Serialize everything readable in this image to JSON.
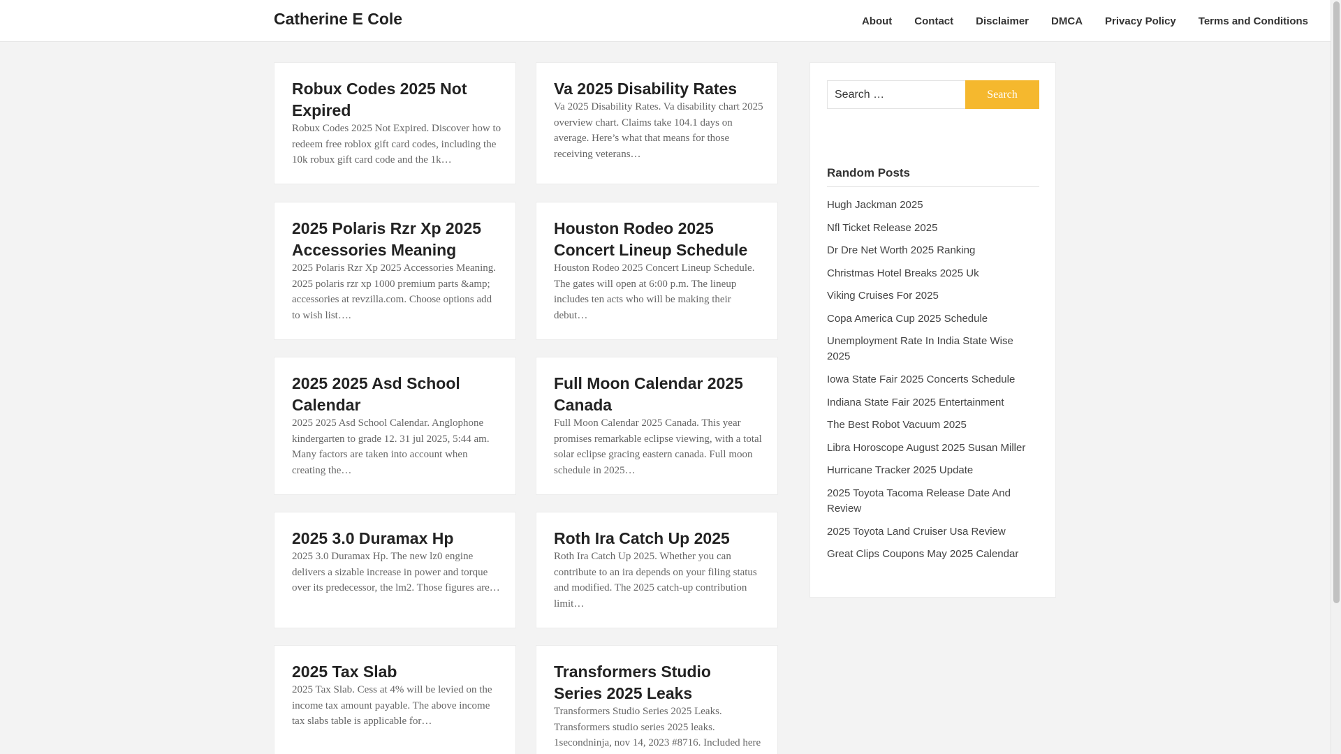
{
  "header": {
    "site_title": "Catherine E Cole",
    "nav": [
      "About",
      "Contact",
      "Disclaimer",
      "DMCA",
      "Privacy Policy",
      "Terms and Conditions"
    ]
  },
  "posts": [
    {
      "title": "Robux Codes 2025 Not Expired",
      "excerpt": "Robux Codes 2025 Not Expired. Discover how to redeem free roblox gift card codes, including the 10k robux gift card code and the 1k…"
    },
    {
      "title": "Va 2025 Disability Rates",
      "excerpt": "Va 2025 Disability Rates. Va disability chart 2025 overview chart. Claims take 104.1 days on average. Here’s what that means for those receiving veterans…"
    },
    {
      "title": "2025 Polaris Rzr Xp 2025 Accessories Meaning",
      "excerpt": "2025 Polaris Rzr Xp 2025 Accessories Meaning. 2025 polaris rzr xp 1000 premium parts &amp; accessories at revzilla.com. Choose options add to wish list…."
    },
    {
      "title": "Houston Rodeo 2025 Concert Lineup Schedule",
      "excerpt": "Houston Rodeo 2025 Concert Lineup Schedule. The gates will open at 6:00 p.m. The lineup includes ten acts who will be making their debut…"
    },
    {
      "title": "2025 2025 Asd School Calendar",
      "excerpt": "2025 2025 Asd School Calendar. Anglophone kindergarten to grade 12. 31 jul 2025, 5:44 am. Many factors are taken into account when creating the…"
    },
    {
      "title": "Full Moon Calendar 2025 Canada",
      "excerpt": "Full Moon Calendar 2025 Canada. This year promises remarkable eclipse viewing, with a total solar eclipse gracing eastern canada. Full moon schedule in 2025…"
    },
    {
      "title": "2025 3.0 Duramax Hp",
      "excerpt": "2025 3.0 Duramax Hp. The new lz0 engine delivers a sizable increase in power and torque over its predecessor, the lm2. Those figures are…"
    },
    {
      "title": "Roth Ira Catch Up 2025",
      "excerpt": "Roth Ira Catch Up 2025. Whether you can contribute to an ira depends on your filing status and modified. The 2025 catch-up contribution limit…"
    },
    {
      "title": "2025 Tax Slab",
      "excerpt": "2025 Tax Slab. Cess at 4% will be levied on the income tax amount payable. The above income tax slabs table is applicable for…"
    },
    {
      "title": "Transformers Studio Series 2025 Leaks",
      "excerpt": "Transformers Studio Series 2025 Leaks. Transformers studio series 2025 leaks. 1secondninja, nov 14, 2023 #8716. Included here"
    }
  ],
  "sidebar": {
    "search_placeholder": "Search …",
    "search_button": "Search",
    "random_posts_title": "Random Posts",
    "random_posts": [
      "Hugh Jackman 2025",
      "Nfl Ticket Release 2025",
      "Dr Dre Net Worth 2025 Ranking",
      "Christmas Hotel Breaks 2025 Uk",
      "Viking Cruises For 2025",
      "Copa America Cup 2025 Schedule",
      "Unemployment Rate In India State Wise 2025",
      "Iowa State Fair 2025 Concerts Schedule",
      "Indiana State Fair 2025 Entertainment",
      "The Best Robot Vacuum 2025",
      "Libra Horoscope August 2025 Susan Miller",
      "Hurricane Tracker 2025 Update",
      "2025 Toyota Tacoma Release Date And Review",
      "2025 Toyota Land Cruiser Usa Review",
      "Great Clips Coupons May 2025 Calendar"
    ]
  }
}
